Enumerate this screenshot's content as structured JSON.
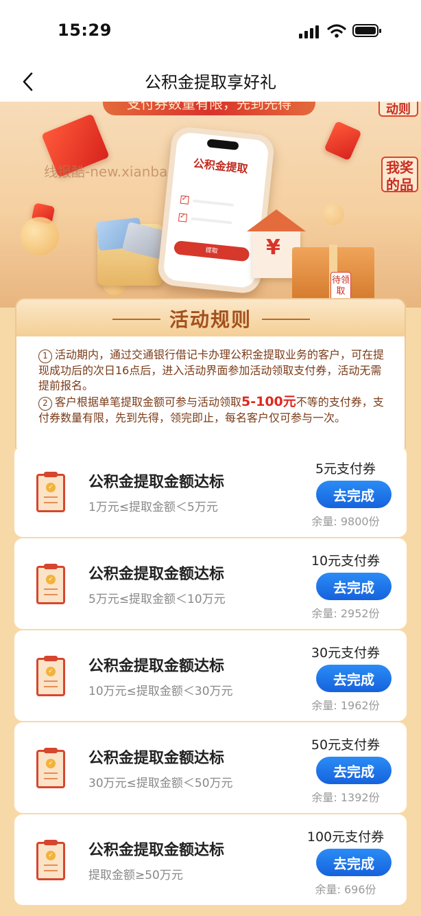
{
  "status_bar": {
    "time": "15:29"
  },
  "nav": {
    "title": "公积金提取享好礼"
  },
  "banner": {
    "ribbon_text": "支付券数量有限，先到先得",
    "side_tag_top": "动则",
    "side_tag_prize": "我奖的品",
    "watermark": "线报酷-new.xianbao.fun",
    "phone_title": "公积金提取",
    "phone_button": "提取",
    "gift_tag": "待领取"
  },
  "rules": {
    "title": "活动规则",
    "items": [
      {
        "num": "1",
        "text": "活动期内，通过交通银行借记卡办理公积金提取业务的客户，可在提现成功后的次日16点后，进入活动界面参加活动领取支付券，活动无需提前报名。"
      },
      {
        "num": "2",
        "text_before": "客户根据单笔提取金额可参与活动领取",
        "highlight": "5-100元",
        "text_after": "不等的支付券，支付券数量有限，先到先得，领完即止，每名客户仅可参与一次。"
      }
    ]
  },
  "tasks": [
    {
      "title": "公积金提取金额达标",
      "desc": "1万元≤提取金额＜5万元",
      "reward": "5元支付券",
      "button": "去完成",
      "stock": "余量: 9800份"
    },
    {
      "title": "公积金提取金额达标",
      "desc": "5万元≤提取金额＜10万元",
      "reward": "10元支付券",
      "button": "去完成",
      "stock": "余量: 2952份"
    },
    {
      "title": "公积金提取金额达标",
      "desc": "10万元≤提取金额＜30万元",
      "reward": "30元支付券",
      "button": "去完成",
      "stock": "余量: 1962份"
    },
    {
      "title": "公积金提取金额达标",
      "desc": "30万元≤提取金额＜50万元",
      "reward": "50元支付券",
      "button": "去完成",
      "stock": "余量: 1392份"
    },
    {
      "title": "公积金提取金额达标",
      "desc": "提取金额≥50万元",
      "reward": "100元支付券",
      "button": "去完成",
      "stock": "余量: 696份"
    }
  ],
  "colors": {
    "accent_blue": "#1f78ee",
    "brand_red": "#d7452e",
    "page_bg": "#f7d9a8"
  }
}
